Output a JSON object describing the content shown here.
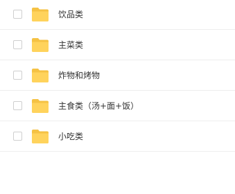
{
  "folder_color": "#ffd35c",
  "folder_tab_color": "#f5c244",
  "items": [
    {
      "label": "饮品类",
      "icon": "folder-icon",
      "checked": false
    },
    {
      "label": "主菜类",
      "icon": "folder-icon",
      "checked": false
    },
    {
      "label": "炸物和烤物",
      "icon": "folder-icon",
      "checked": false
    },
    {
      "label": "主食类（汤+面+饭）",
      "icon": "folder-icon",
      "checked": false
    },
    {
      "label": "小吃类",
      "icon": "folder-icon",
      "checked": false
    }
  ]
}
